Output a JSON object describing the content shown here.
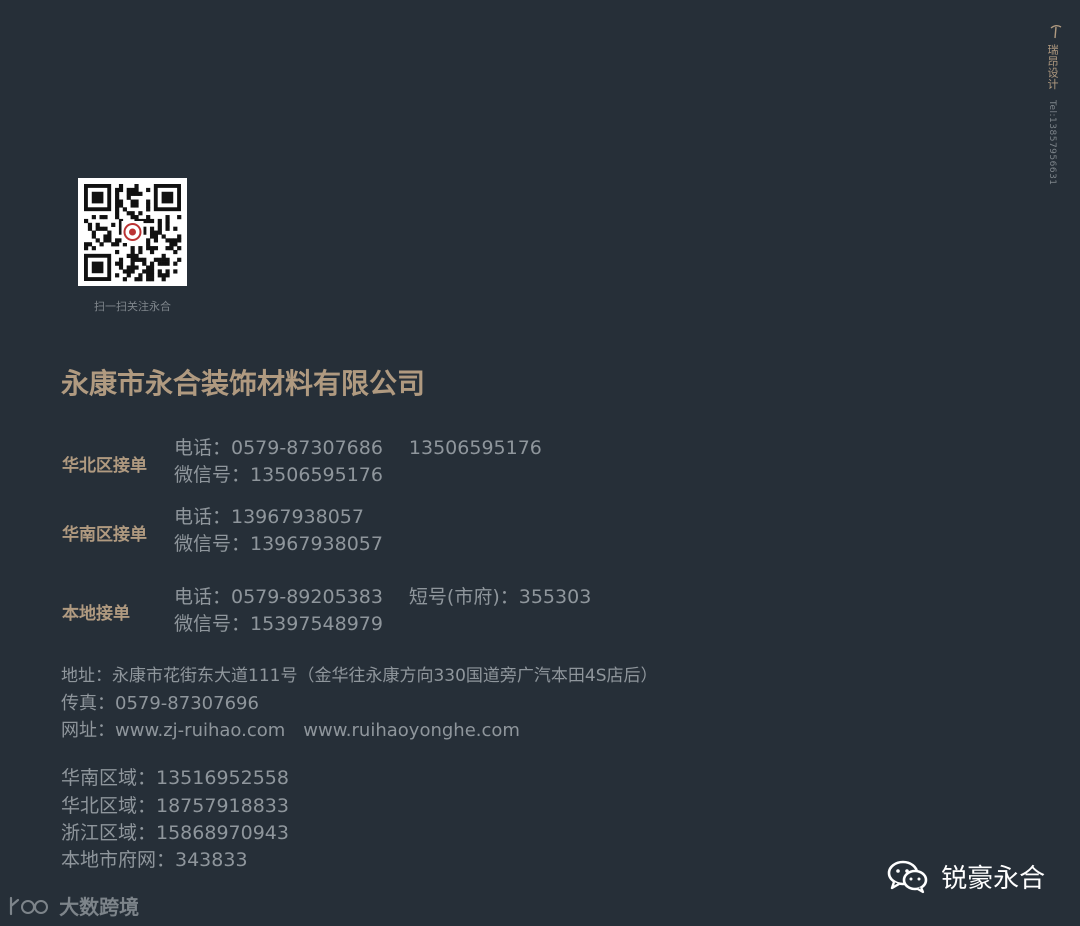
{
  "side_brand": {
    "name": "瑞昂设计",
    "tel": "Tel:13857956631"
  },
  "qr": {
    "caption": "扫一扫关注永合"
  },
  "company": {
    "name": "永康市永合装饰材料有限公司"
  },
  "regions": [
    {
      "label": "华北区接单",
      "lines": [
        {
          "parts": [
            "电话：0579-87307686",
            "13506595176"
          ]
        },
        {
          "parts": [
            "微信号：13506595176"
          ]
        }
      ]
    },
    {
      "label": "华南区接单",
      "lines": [
        {
          "parts": [
            "电话：13967938057"
          ]
        },
        {
          "parts": [
            "微信号：13967938057"
          ]
        }
      ]
    },
    {
      "label": "本地接单",
      "lines": [
        {
          "parts": [
            "电话：0579-89205383",
            "短号(市府)：355303"
          ]
        },
        {
          "parts": [
            "微信号：15397548979"
          ]
        }
      ]
    }
  ],
  "address_block": [
    {
      "parts": [
        "地址：永康市花街东大道111号（金华往永康方向330国道旁广汽本田4S店后）"
      ]
    },
    {
      "parts": [
        "传真：0579-87307696"
      ]
    },
    {
      "parts": [
        "网址：www.zj-ruihao.com",
        "www.ruihaoyonghe.com"
      ]
    }
  ],
  "area_contacts": [
    "华南区域：13516952558",
    "华北区域：18757918833",
    "浙江区域：15868970943",
    "本地市府网：343833"
  ],
  "footer_logo": {
    "text": "大数跨境"
  },
  "wechat": {
    "account": "锐豪永合"
  }
}
